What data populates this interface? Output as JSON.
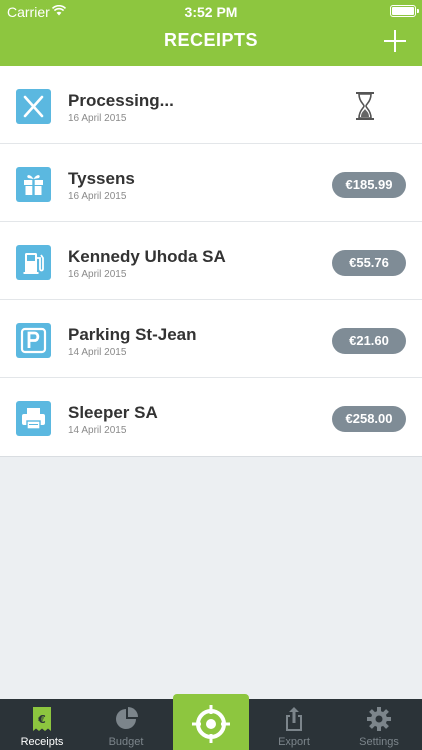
{
  "status_bar": {
    "carrier": "Carrier",
    "time": "3:52 PM"
  },
  "header": {
    "title": "RECEIPTS",
    "add_icon": "plus-icon"
  },
  "receipts": [
    {
      "merchant": "Processing...",
      "date": "16 April 2015",
      "amount": "",
      "icon": "restaurant-icon",
      "status": "processing"
    },
    {
      "merchant": "Tyssens",
      "date": "16 April 2015",
      "amount": "€185.99",
      "icon": "gift-icon"
    },
    {
      "merchant": "Kennedy Uhoda SA",
      "date": "16 April 2015",
      "amount": "€55.76",
      "icon": "fuel-icon"
    },
    {
      "merchant": "Parking St-Jean",
      "date": "14 April 2015",
      "amount": "€21.60",
      "icon": "parking-icon"
    },
    {
      "merchant": "Sleeper SA",
      "date": "14 April 2015",
      "amount": "€258.00",
      "icon": "printer-icon"
    }
  ],
  "tabbar": {
    "tabs": [
      {
        "label": "Receipts",
        "icon": "receipt-icon",
        "active": true
      },
      {
        "label": "Budget",
        "icon": "pie-chart-icon",
        "active": false
      },
      {
        "label": "",
        "icon": "scan-target-icon",
        "active": false
      },
      {
        "label": "Export",
        "icon": "export-icon",
        "active": false
      },
      {
        "label": "Settings",
        "icon": "gear-icon",
        "active": false
      }
    ]
  },
  "colors": {
    "brand": "#8dc63f",
    "category_icon": "#5bb8e0",
    "amount_badge": "#7f8c96",
    "tabbar": "#2b3338"
  }
}
